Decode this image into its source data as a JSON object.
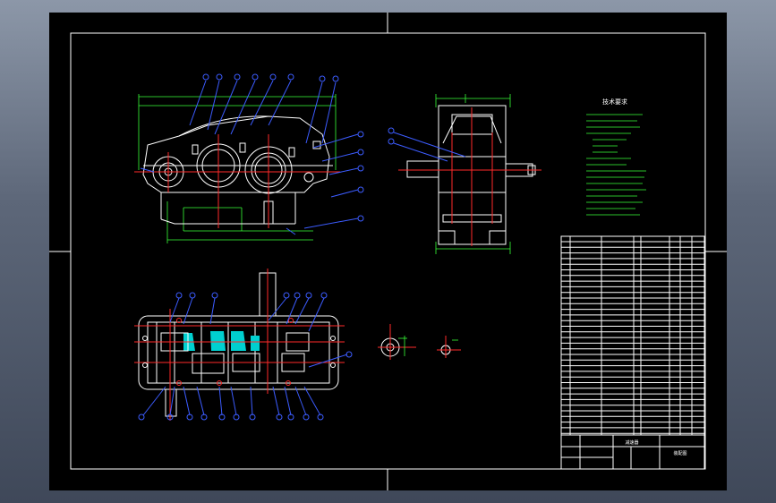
{
  "drawing": {
    "title": "技术要求",
    "title_block": {
      "name_cell": "减速器",
      "drawing_cell": "装配图"
    }
  },
  "colors": {
    "background": "#000000",
    "outline": "#ffffff",
    "dimension": "#39ff39",
    "leader": "#3c5cff",
    "centerline": "#ff2a2a",
    "section_fill": "#00d0d0"
  }
}
